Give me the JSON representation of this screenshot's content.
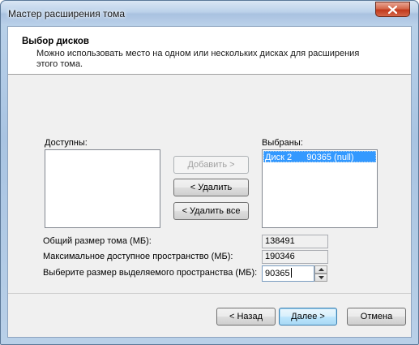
{
  "window": {
    "title": "Мастер расширения тома"
  },
  "header": {
    "title": "Выбор дисков",
    "description": "Можно использовать место на одном или нескольких дисках для расширения этого тома."
  },
  "available": {
    "label": "Доступны:",
    "items": []
  },
  "selected": {
    "label": "Выбраны:",
    "items": [
      {
        "text": "Диск 2      90365 (null)"
      }
    ]
  },
  "buttons": {
    "add": "Добавить >",
    "remove": "< Удалить",
    "remove_all": "< Удалить все",
    "back": "< Назад",
    "next": "Далее >",
    "cancel": "Отмена"
  },
  "fields": {
    "total_size_label": "Общий размер тома (МБ):",
    "total_size_value": "138491",
    "max_space_label": "Максимальное доступное пространство (МБ):",
    "max_space_value": "190346",
    "alloc_label": "Выберите размер выделяемого пространства (МБ):",
    "alloc_value": "90365"
  },
  "icons": {
    "close": "close-icon",
    "spin_up": "arrow-up-icon",
    "spin_down": "arrow-down-icon"
  }
}
